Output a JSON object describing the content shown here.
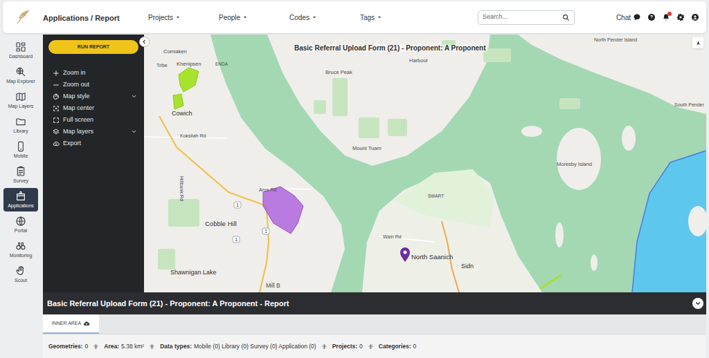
{
  "header": {
    "breadcrumb": "Applications / Report",
    "nav": [
      {
        "label": "Projects"
      },
      {
        "label": "People"
      },
      {
        "label": "Codes"
      },
      {
        "label": "Tags"
      }
    ],
    "search": {
      "placeholder": "Search..."
    },
    "chat": "Chat",
    "notifications": {
      "unread": true
    }
  },
  "sidebar": {
    "items": [
      {
        "label": "Dashboard",
        "selected": false
      },
      {
        "label": "Map Explorer",
        "selected": false
      },
      {
        "label": "Map Layers",
        "selected": false
      },
      {
        "label": "Library",
        "selected": false
      },
      {
        "label": "Mobile",
        "selected": false
      },
      {
        "label": "Survey",
        "selected": false
      },
      {
        "label": "Applications",
        "selected": true
      },
      {
        "label": "Portal",
        "selected": false
      },
      {
        "label": "Monitoring",
        "selected": false
      },
      {
        "label": "Scout",
        "selected": false
      }
    ]
  },
  "tools": {
    "run_button": "RUN REPORT",
    "items": [
      {
        "label": "Zoom in",
        "submenu": false
      },
      {
        "label": "Zoom out",
        "submenu": false
      },
      {
        "label": "Map style",
        "submenu": true
      },
      {
        "label": "Map center",
        "submenu": false
      },
      {
        "label": "Full screen",
        "submenu": false
      },
      {
        "label": "Map layers",
        "submenu": true
      },
      {
        "label": "Export",
        "submenu": false
      }
    ]
  },
  "map": {
    "title": "Basic Referral Upload Form (21) - Proponent: A Proponent",
    "labels": [
      "Comiaken",
      "Tribe",
      "Khenipsen",
      "ENDA",
      "Cowich",
      "Koksilah Rd",
      "Hillbank Rd",
      "Aros Rd",
      "Cobble Hill",
      "Shawnigan Lake",
      "Mill B",
      "Bruce Peak",
      "Harbour",
      "Mount Tuam",
      "Moresby Island",
      "North Pender Island",
      "South Pender",
      "SWART",
      "Wain Rd",
      "North Saanich",
      "Sidn"
    ],
    "shields": [
      "1",
      "1",
      "1"
    ]
  },
  "report": {
    "title": "Basic Referral Upload Form (21) - Proponent: A Proponent - Report",
    "tabs": [
      {
        "label": "INNER AREA",
        "selected": true
      }
    ],
    "stats": [
      {
        "label": "Geometries:",
        "value": "0"
      },
      {
        "label": "Area:",
        "value": "5.38 km²"
      },
      {
        "label": "Data types:",
        "value": "Mobile (0) Library (0) Survey (0) Application (0)"
      },
      {
        "label": "Projects:",
        "value": "0"
      },
      {
        "label": "Categories:",
        "value": "0"
      }
    ]
  }
}
